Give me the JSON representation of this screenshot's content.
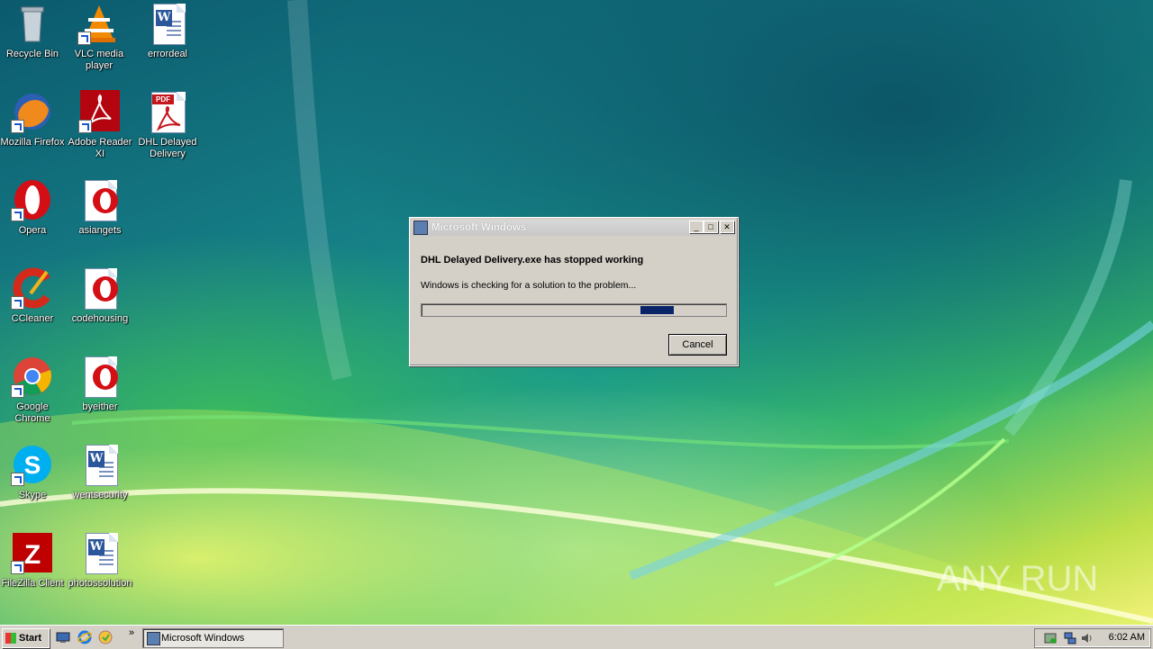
{
  "desktop": {
    "icons": [
      {
        "label": "Recycle Bin",
        "icon": "recycle-bin-icon"
      },
      {
        "label": "VLC media player",
        "icon": "vlc-icon"
      },
      {
        "label": "errordeal",
        "icon": "word-document-icon"
      },
      {
        "label": "Mozilla Firefox",
        "icon": "firefox-icon"
      },
      {
        "label": "Adobe Reader XI",
        "icon": "adobe-reader-icon"
      },
      {
        "label": "DHL Delayed Delivery",
        "icon": "pdf-file-icon"
      },
      {
        "label": "Opera",
        "icon": "opera-icon"
      },
      {
        "label": "asiangets",
        "icon": "opera-document-icon"
      },
      {
        "label": "CCleaner",
        "icon": "ccleaner-icon"
      },
      {
        "label": "codehousing",
        "icon": "opera-document-icon"
      },
      {
        "label": "Google Chrome",
        "icon": "chrome-icon"
      },
      {
        "label": "byeither",
        "icon": "opera-document-icon"
      },
      {
        "label": "Skype",
        "icon": "skype-icon"
      },
      {
        "label": "wentsecurity",
        "icon": "word-document-icon"
      },
      {
        "label": "FileZilla Client",
        "icon": "filezilla-icon"
      },
      {
        "label": "photossolution",
        "icon": "word-document-icon"
      }
    ],
    "watermark": "ANY RUN"
  },
  "dialog": {
    "title": "Microsoft Windows",
    "heading": "DHL Delayed Delivery.exe has stopped working",
    "message": "Windows is checking for a solution to the problem...",
    "progress": {
      "indeterminate": true,
      "marquee_start": 0.72,
      "marquee_end": 0.83
    },
    "cancel_label": "Cancel",
    "controls": {
      "minimize": "minimize-icon",
      "maximize": "maximize-icon",
      "close": "close-icon"
    }
  },
  "taskbar": {
    "start_label": "Start",
    "quick_launch": [
      "show-desktop-icon",
      "internet-explorer-icon",
      "media-player-icon"
    ],
    "chevron": "»",
    "task_label": "Microsoft Windows",
    "tray_icons": [
      "security-icon",
      "network-icon",
      "volume-icon"
    ],
    "clock": "6:02 AM"
  },
  "colors": {
    "accent": "#0a246a",
    "chrome": "#d4d0c8"
  }
}
